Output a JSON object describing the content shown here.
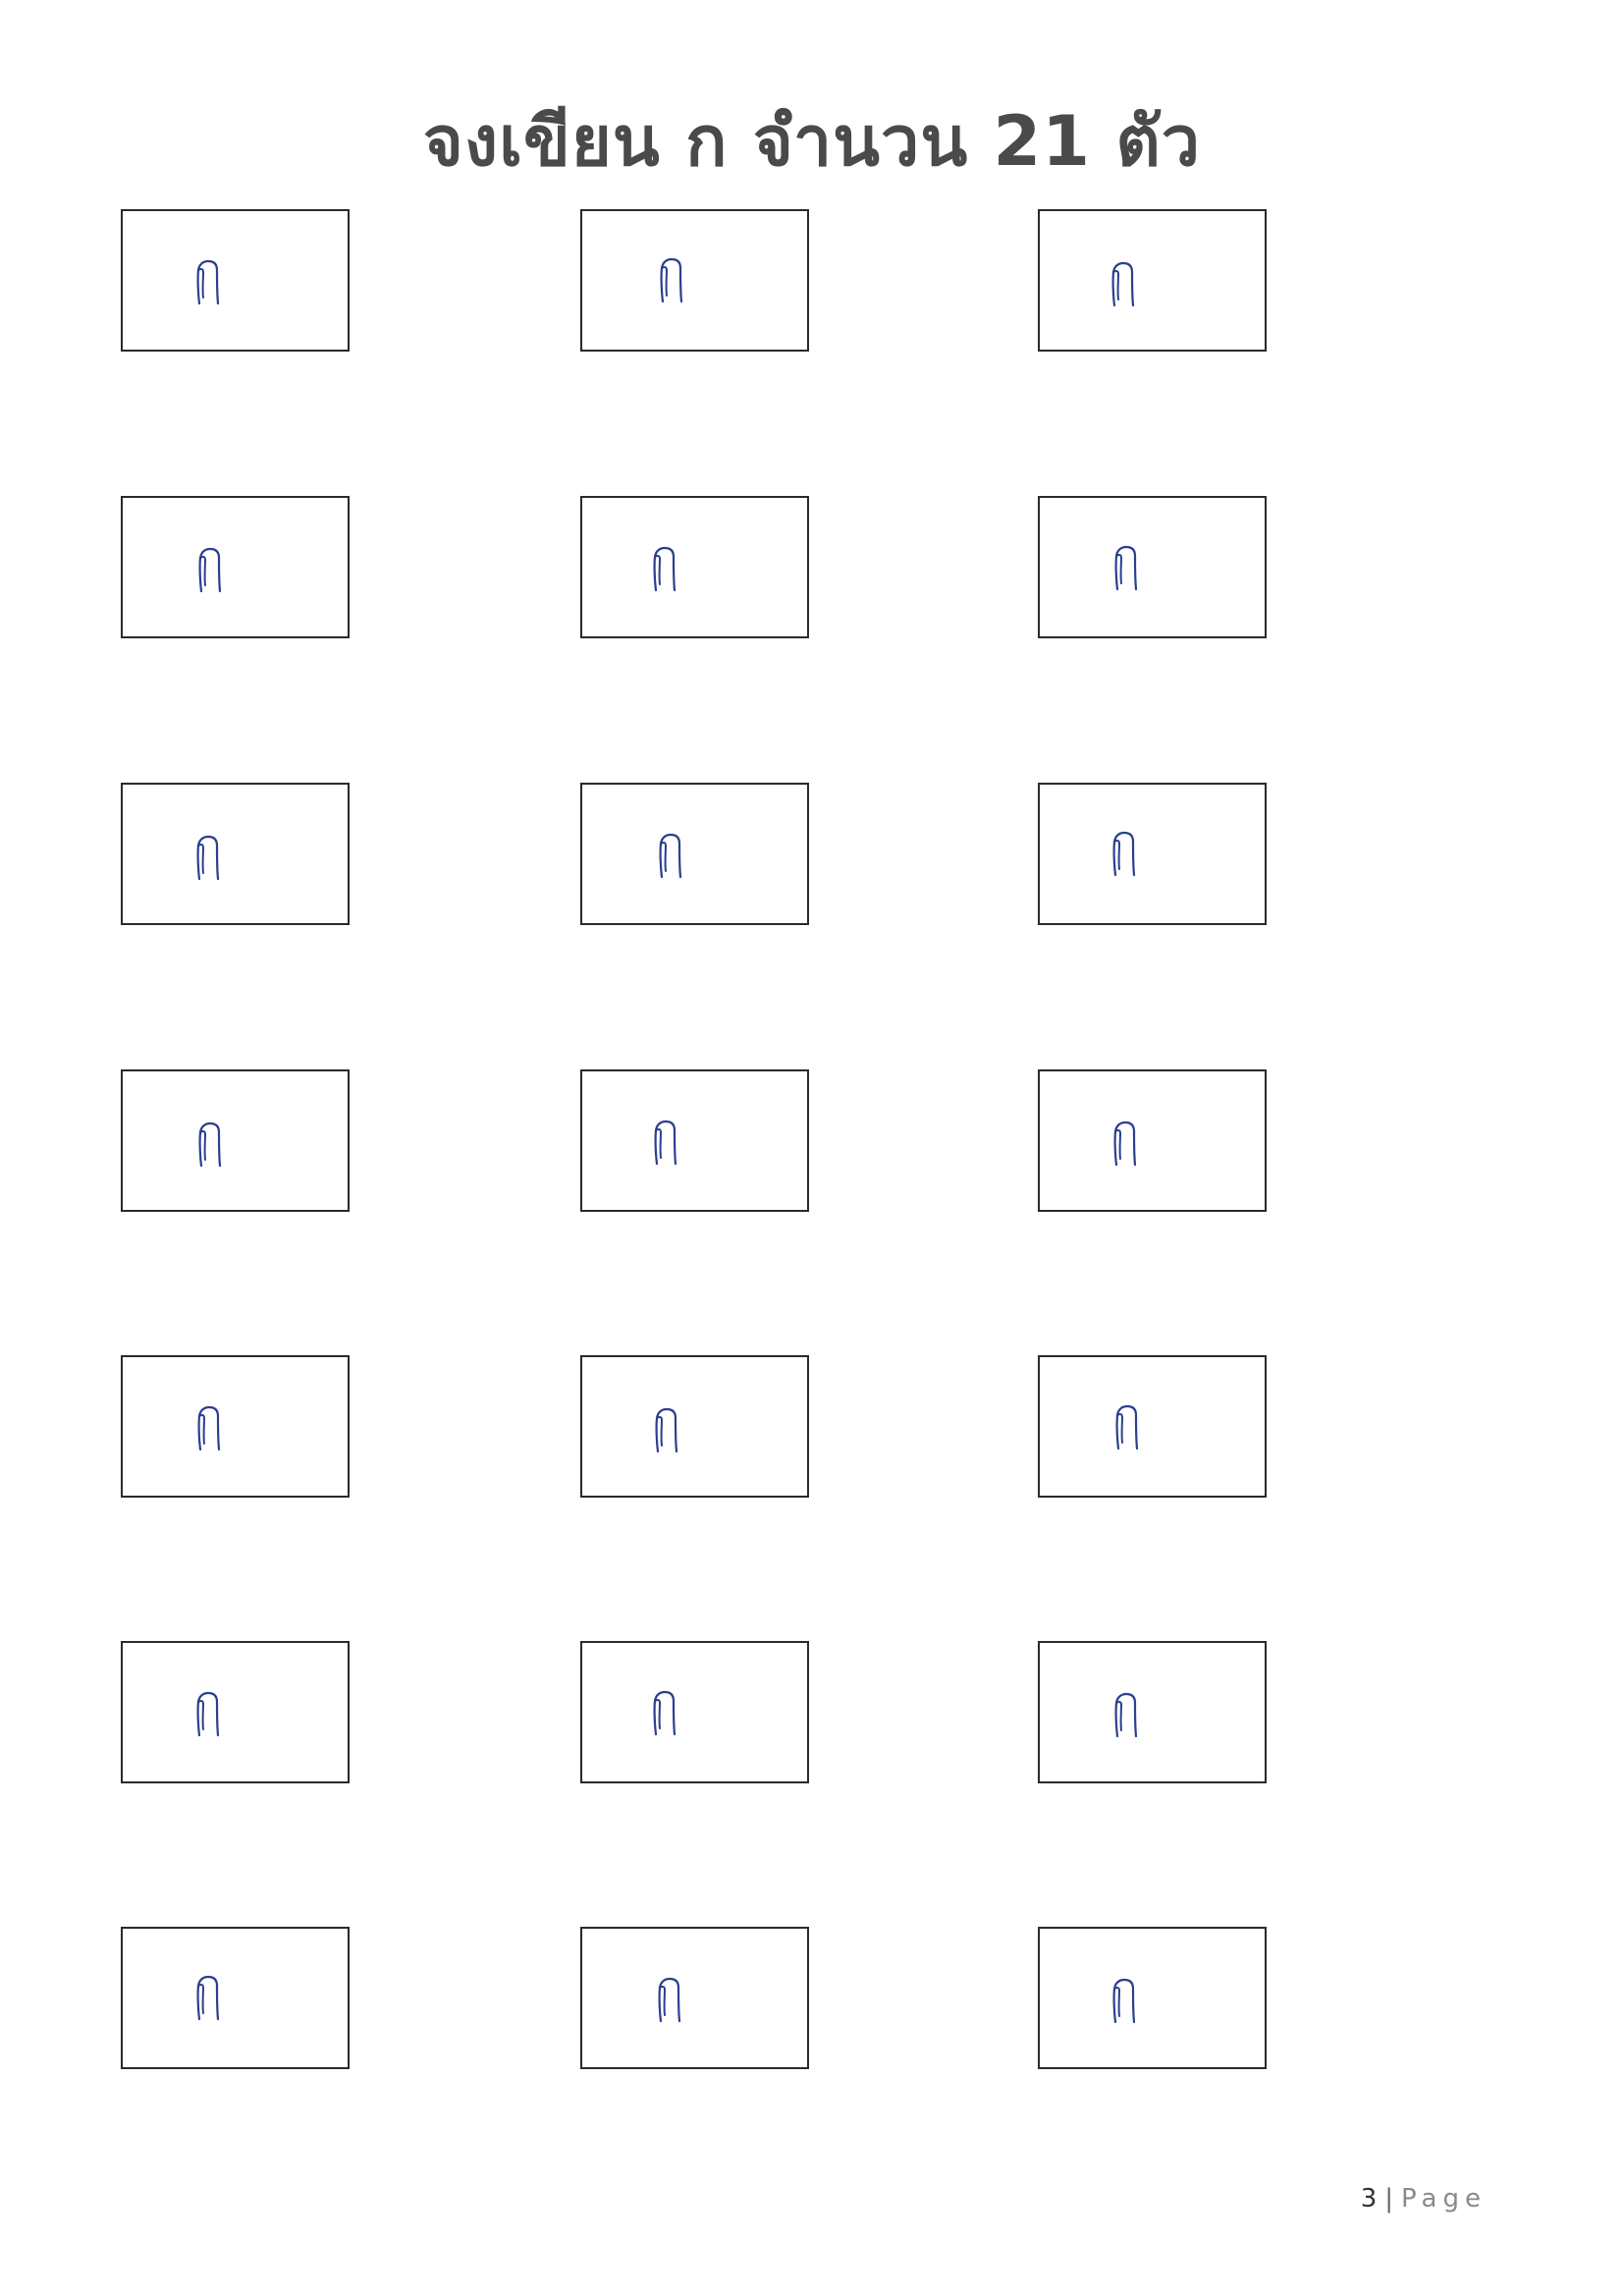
{
  "document": {
    "title": "จงเขียน ก จำนวน 21 ตัว",
    "handwritten_letter": "ก",
    "ink_color": "#2b3f8f",
    "cells": [
      {
        "row": 1,
        "col": 1
      },
      {
        "row": 1,
        "col": 2
      },
      {
        "row": 1,
        "col": 3
      },
      {
        "row": 2,
        "col": 1
      },
      {
        "row": 2,
        "col": 2
      },
      {
        "row": 2,
        "col": 3
      },
      {
        "row": 3,
        "col": 1
      },
      {
        "row": 3,
        "col": 2
      },
      {
        "row": 3,
        "col": 3
      },
      {
        "row": 4,
        "col": 1
      },
      {
        "row": 4,
        "col": 2
      },
      {
        "row": 4,
        "col": 3
      },
      {
        "row": 5,
        "col": 1
      },
      {
        "row": 5,
        "col": 2
      },
      {
        "row": 5,
        "col": 3
      },
      {
        "row": 6,
        "col": 1
      },
      {
        "row": 6,
        "col": 2
      },
      {
        "row": 6,
        "col": 3
      },
      {
        "row": 7,
        "col": 1
      },
      {
        "row": 7,
        "col": 2
      },
      {
        "row": 7,
        "col": 3
      }
    ]
  },
  "footer": {
    "page_number": "3",
    "separator": "|",
    "page_word": "Page"
  }
}
